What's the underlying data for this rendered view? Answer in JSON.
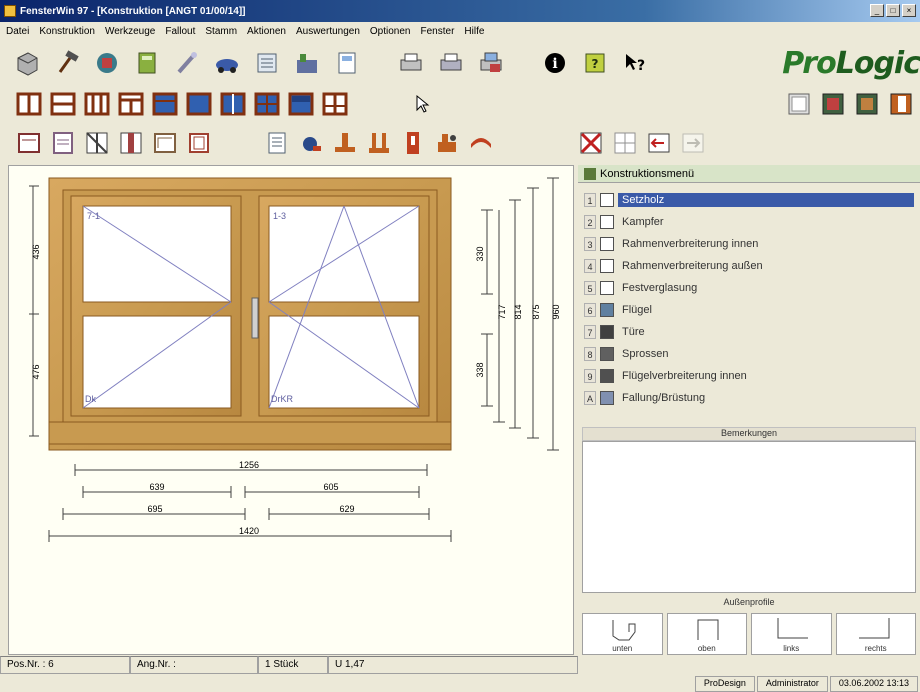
{
  "window": {
    "title": "FensterWin 97 - [Konstruktion  [ANGT 01/00/14]]"
  },
  "menu": [
    "Datei",
    "Konstruktion",
    "Werkzeuge",
    "Fallout",
    "Stamm",
    "Aktionen",
    "Auswertungen",
    "Optionen",
    "Fenster",
    "Hilfe"
  ],
  "logo": {
    "part1": "Pro",
    "part2": "Logic"
  },
  "drawing": {
    "labels": {
      "sash_left_top": "7-1",
      "sash_right_top": "1-3",
      "sash_left_bottom": "Dk",
      "sash_right_bottom": "DrKR"
    },
    "dims": {
      "left_upper": "436",
      "left_lower": "476",
      "right_330": "330",
      "right_717": "717",
      "right_814": "814",
      "right_875": "875",
      "right_960": "960",
      "right_338": "338",
      "bottom_1256": "1256",
      "bottom_639": "639",
      "bottom_605": "605",
      "bottom_695": "695",
      "bottom_629": "629",
      "bottom_1420": "1420"
    }
  },
  "panel": {
    "title": "Konstruktionsmenü",
    "items": [
      {
        "num": "1",
        "label": "Setzholz",
        "active": true
      },
      {
        "num": "2",
        "label": "Kampfer",
        "active": false
      },
      {
        "num": "3",
        "label": "Rahmenverbreiterung innen",
        "active": false
      },
      {
        "num": "4",
        "label": "Rahmenverbreiterung außen",
        "active": false
      },
      {
        "num": "5",
        "label": "Festverglasung",
        "active": false
      },
      {
        "num": "6",
        "label": "Flügel",
        "active": false
      },
      {
        "num": "7",
        "label": "Türe",
        "active": false
      },
      {
        "num": "8",
        "label": "Sprossen",
        "active": false
      },
      {
        "num": "9",
        "label": "Flügelverbreiterung innen",
        "active": false
      },
      {
        "num": "A",
        "label": "Fallung/Brüstung",
        "active": false
      }
    ],
    "remarks_title": "Bemerkungen",
    "profiles_title": "Außenprofile",
    "profiles": [
      "unten",
      "oben",
      "links",
      "rechts"
    ]
  },
  "status": {
    "pos": "Pos.Nr. : 6",
    "ang": "Ang.Nr. :",
    "count": "1 Stück",
    "u": "U 1,47",
    "design": "ProDesign",
    "user": "Administrator",
    "datetime": "03.06.2002 13:13"
  },
  "colors": {
    "wood": "#c89a50",
    "wood_dark": "#9a6a28",
    "glass": "#ffffff",
    "sash_lines": "#8080c0",
    "logo_green": "#2a7a2a"
  }
}
